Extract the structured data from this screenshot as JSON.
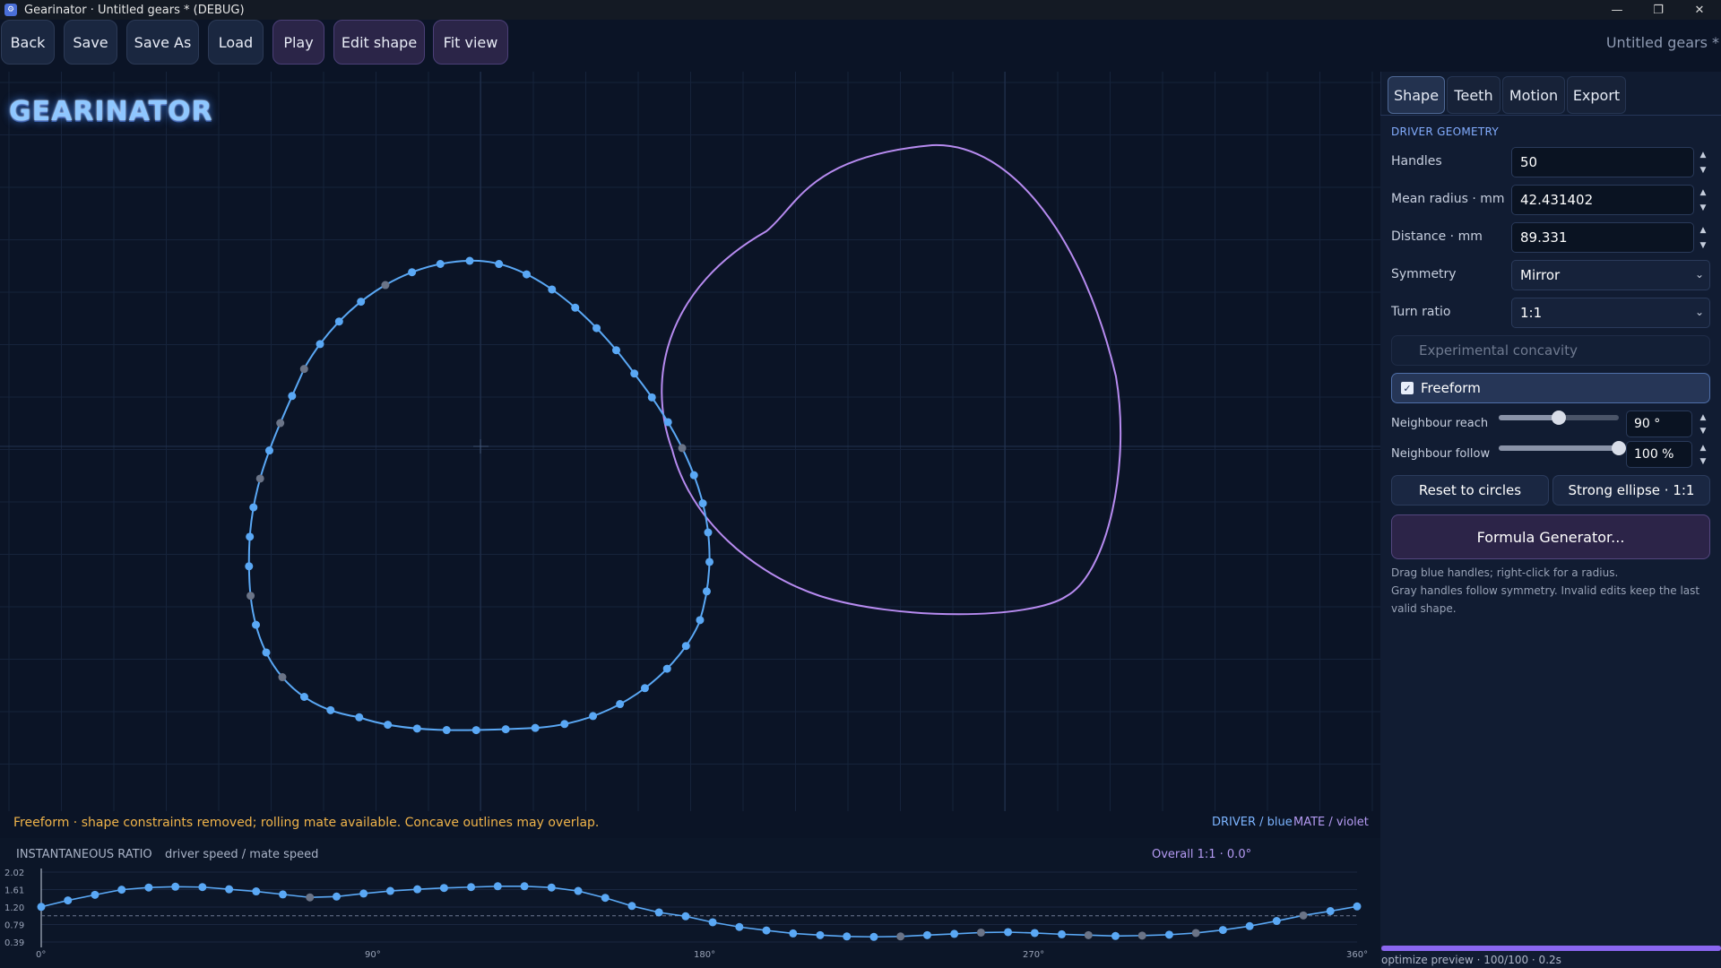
{
  "window": {
    "title": "Gearinator · Untitled gears * (DEBUG)",
    "controls": {
      "minimize": "—",
      "restore": "❐",
      "close": "✕"
    }
  },
  "toolbar": {
    "back": "Back",
    "save": "Save",
    "save_as": "Save As",
    "load": "Load",
    "play": "Play",
    "edit_shape": "Edit shape",
    "fit_view": "Fit view",
    "doc_name": "Untitled gears *"
  },
  "logo_text": "GEARINATOR",
  "status": {
    "message": "Freeform · shape constraints removed; rolling mate available. Concave outlines may overlap.",
    "legend_driver": "DRIVER / blue",
    "legend_mate": "MATE / violet"
  },
  "colors": {
    "driver": "#5aa8f5",
    "mate": "#b78bf0",
    "gray_handle": "#6b7487",
    "warning": "#f0b44a"
  },
  "ratio": {
    "title": "INSTANTANEOUS RATIO",
    "separator": "·",
    "subtitle": "driver speed / mate speed",
    "overall": "Overall 1:1  ·  0.0°"
  },
  "panel": {
    "tabs": [
      "Shape",
      "Teeth",
      "Motion",
      "Export"
    ],
    "active_tab": "Shape",
    "section_title": "DRIVER GEOMETRY",
    "handles_label": "Handles",
    "handles_value": "50",
    "mean_radius_label": "Mean radius · mm",
    "mean_radius_value": "42.431402",
    "distance_label": "Distance · mm",
    "distance_value": "89.331",
    "symmetry_label": "Symmetry",
    "symmetry_value": "Mirror",
    "turn_ratio_label": "Turn ratio",
    "turn_ratio_value": "1:1",
    "concavity_label": "Experimental concavity",
    "freeform_label": "Freeform",
    "freeform_checked": true,
    "neighbour_reach_label": "Neighbour reach",
    "neighbour_reach_value": "90 °",
    "neighbour_reach_fraction": 0.5,
    "neighbour_follow_label": "Neighbour follow",
    "neighbour_follow_value": "100 %",
    "neighbour_follow_fraction": 1.0,
    "reset_button": "Reset to circles",
    "ellipse_button": "Strong ellipse · 1:1",
    "formula_button": "Formula Generator...",
    "help_line1": "Drag blue handles; right-click for a radius.",
    "help_line2": "Gray handles follow symmetry. Invalid edits keep the last",
    "help_line3": "valid shape."
  },
  "progress": {
    "text": "optimize preview · 100/100 · 0.2s",
    "fraction": 1.0
  },
  "chart_data": {
    "type": "line",
    "title": "INSTANTANEOUS RATIO",
    "x_ticks": [
      "0°",
      "90°",
      "180°",
      "270°",
      "360°"
    ],
    "y_ticks": [
      "2.02",
      "1.61",
      "1.20",
      "0.79",
      "0.39"
    ],
    "xlim": [
      0,
      360
    ],
    "ylim": [
      0.39,
      2.02
    ],
    "reference": 1.0,
    "x": [
      0,
      7.3,
      14.7,
      22,
      29.4,
      36.7,
      44.1,
      51.4,
      58.8,
      66.1,
      73.5,
      80.8,
      88.2,
      95.5,
      102.9,
      110.2,
      117.6,
      124.9,
      132.2,
      139.6,
      146.9,
      154.3,
      161.6,
      169,
      176.3,
      183.7,
      191,
      198.4,
      205.7,
      213.1,
      220.4,
      227.8,
      235.1,
      242.4,
      249.8,
      257.1,
      264.5,
      271.8,
      279.2,
      286.5,
      293.9,
      301.2,
      308.6,
      315.9,
      323.3,
      330.6,
      338,
      345.3,
      352.7,
      360
    ],
    "values": [
      1.21,
      1.36,
      1.49,
      1.61,
      1.66,
      1.68,
      1.67,
      1.62,
      1.57,
      1.5,
      1.43,
      1.45,
      1.52,
      1.58,
      1.62,
      1.65,
      1.67,
      1.69,
      1.69,
      1.66,
      1.58,
      1.42,
      1.23,
      1.08,
      0.99,
      0.85,
      0.74,
      0.66,
      0.59,
      0.55,
      0.52,
      0.51,
      0.52,
      0.55,
      0.58,
      0.61,
      0.62,
      0.6,
      0.57,
      0.55,
      0.53,
      0.54,
      0.56,
      0.6,
      0.67,
      0.76,
      0.88,
      1.01,
      1.11,
      1.22
    ],
    "handle_kind": [
      "driver",
      "driver",
      "driver",
      "driver",
      "driver",
      "driver",
      "driver",
      "driver",
      "driver",
      "driver",
      "gray",
      "driver",
      "driver",
      "driver",
      "driver",
      "driver",
      "driver",
      "driver",
      "driver",
      "driver",
      "driver",
      "driver",
      "driver",
      "driver",
      "driver",
      "driver",
      "driver",
      "driver",
      "driver",
      "driver",
      "driver",
      "driver",
      "gray",
      "driver",
      "driver",
      "gray",
      "driver",
      "driver",
      "driver",
      "gray",
      "driver",
      "gray",
      "driver",
      "gray",
      "driver",
      "driver",
      "driver",
      "gray",
      "driver",
      "driver"
    ]
  }
}
